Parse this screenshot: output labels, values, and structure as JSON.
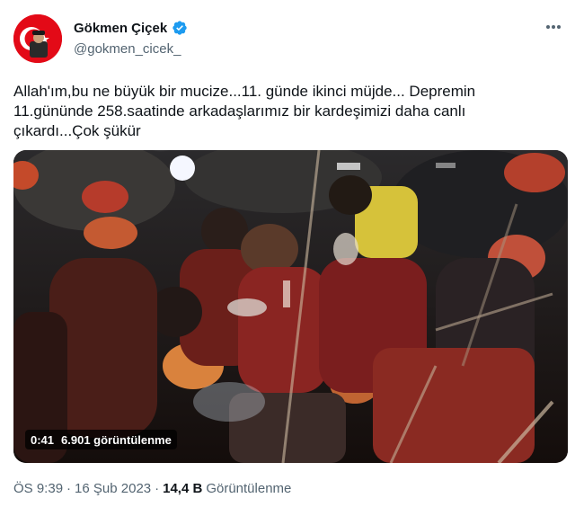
{
  "author": {
    "display_name": "Gökmen Çiçek",
    "handle": "@gokmen_cicek_",
    "verified": true
  },
  "tweet": {
    "text_lines": [
      "Allah'ım,bu ne büyük bir mucize...11. günde ikinci müjde... Depremin",
      "11.gününde 258.saatinde arkadaşlarımız bir kardeşimizi daha canlı",
      "çıkardı...Çok şükür"
    ]
  },
  "media": {
    "duration": "0:41",
    "views_label": "6.901 görüntülenme"
  },
  "footer": {
    "time": "ÖS 9:39",
    "separator": "·",
    "date": "16 Şub 2023",
    "views_count": "14,4 B",
    "views_label": "Görüntülenme"
  },
  "icons": {
    "verified": "verified-badge-icon",
    "more": "more-options-icon"
  },
  "colors": {
    "text_primary": "#0f1419",
    "text_secondary": "#536471",
    "verified_blue": "#1d9bf0",
    "avatar_red": "#e30a17"
  }
}
